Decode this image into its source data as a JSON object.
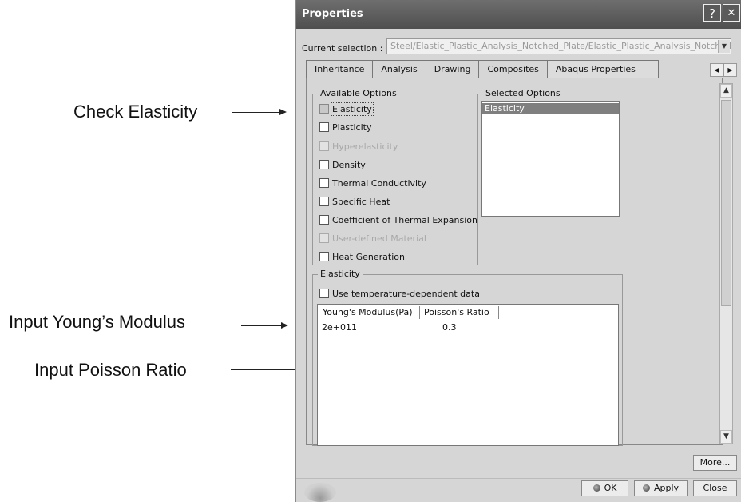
{
  "annotations": {
    "check_elasticity": "Check Elasticity",
    "input_youngs": "Input Young’s Modulus",
    "input_poisson": "Input Poisson Ratio"
  },
  "dialog": {
    "title": "Properties",
    "help_glyph": "?",
    "close_glyph": "✕",
    "current_selection_label": "Current selection :",
    "current_selection_value": "Steel/Elastic_Plastic_Analysis_Notched_Plate/Elastic_Plastic_Analysis_Notched_",
    "tabs": [
      "Inheritance",
      "Analysis",
      "Drawing",
      "Composites",
      "Abaqus Properties"
    ],
    "active_tab": "Abaqus Properties",
    "available_options_label": "Available Options",
    "selected_options_label": "Selected Options",
    "available_options": [
      {
        "label": "Elasticity",
        "checked": true,
        "enabled": true
      },
      {
        "label": "Plasticity",
        "checked": false,
        "enabled": true
      },
      {
        "label": "Hyperelasticity",
        "checked": false,
        "enabled": false
      },
      {
        "label": "Density",
        "checked": false,
        "enabled": true
      },
      {
        "label": "Thermal Conductivity",
        "checked": false,
        "enabled": true
      },
      {
        "label": "Specific Heat",
        "checked": false,
        "enabled": true
      },
      {
        "label": "Coefficient of Thermal Expansion",
        "checked": false,
        "enabled": true
      },
      {
        "label": "User-defined Material",
        "checked": false,
        "enabled": false
      },
      {
        "label": "Heat Generation",
        "checked": false,
        "enabled": true
      }
    ],
    "selected_options": [
      "Elasticity"
    ],
    "elasticity_group_label": "Elasticity",
    "temp_dependent_label": "Use temperature-dependent data",
    "table": {
      "columns": [
        "Young's Modulus(Pa)",
        "Poisson's Ratio"
      ],
      "rows": [
        [
          "2e+011",
          "0.3"
        ]
      ]
    },
    "buttons": {
      "more": "More...",
      "ok": "OK",
      "apply": "Apply",
      "close": "Close"
    }
  },
  "colors": {
    "titlebar": "#5a5a5a",
    "selection_highlight": "#7f7f7f",
    "dialog_bg": "#d6d6d6"
  }
}
